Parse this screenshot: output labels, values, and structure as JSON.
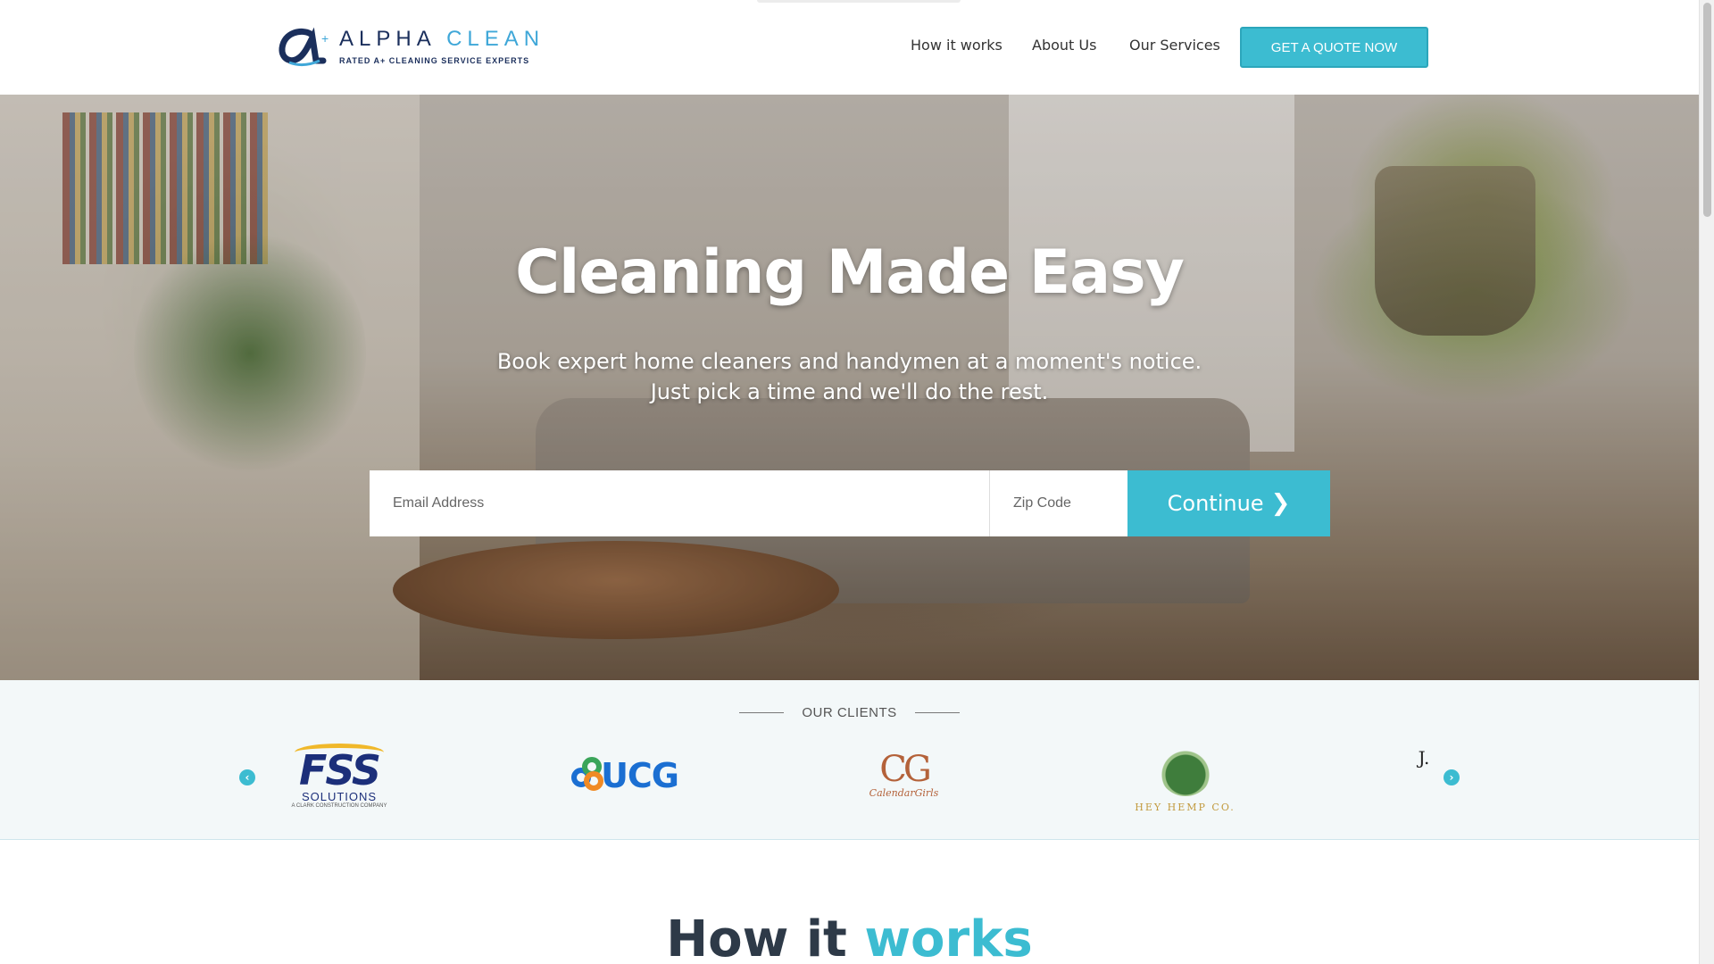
{
  "brand": {
    "name_part1": "ALPHA",
    "name_part2": "CLEAN",
    "tagline": "RATED A+ CLEANING SERVICE EXPERTS"
  },
  "nav": {
    "items": [
      {
        "label": "How it works"
      },
      {
        "label": "About Us"
      },
      {
        "label": "Our Services"
      }
    ],
    "cta_label": "GET A QUOTE NOW"
  },
  "hero": {
    "title": "Cleaning Made Easy",
    "subtitle_line1": "Book expert home cleaners and handymen at a moment's notice.",
    "subtitle_line2": "Just pick a time and we'll do the rest.",
    "email_placeholder": "Email Address",
    "zip_placeholder": "Zip Code",
    "continue_label": "Continue"
  },
  "clients": {
    "heading": "OUR CLIENTS",
    "logos": [
      {
        "name": "FSS",
        "sub": "SOLUTIONS",
        "tagline": "A CLARK CONSTRUCTION COMPANY"
      },
      {
        "name": "UCG"
      },
      {
        "name": "CG",
        "sub": "CalendarGirls"
      },
      {
        "name": "HEY HEMP CO."
      },
      {
        "name": "J."
      }
    ],
    "prev_icon": "chevron-left-icon",
    "next_icon": "chevron-right-icon"
  },
  "how_it_works": {
    "title_part1": "How it",
    "title_part2": "works"
  },
  "colors": {
    "accent": "#3cbcd1",
    "brand_navy": "#1b2f5c",
    "brand_blue": "#3fa7d8",
    "clients_bg": "#f3f8f9",
    "heading_dark": "#2e3a48"
  }
}
